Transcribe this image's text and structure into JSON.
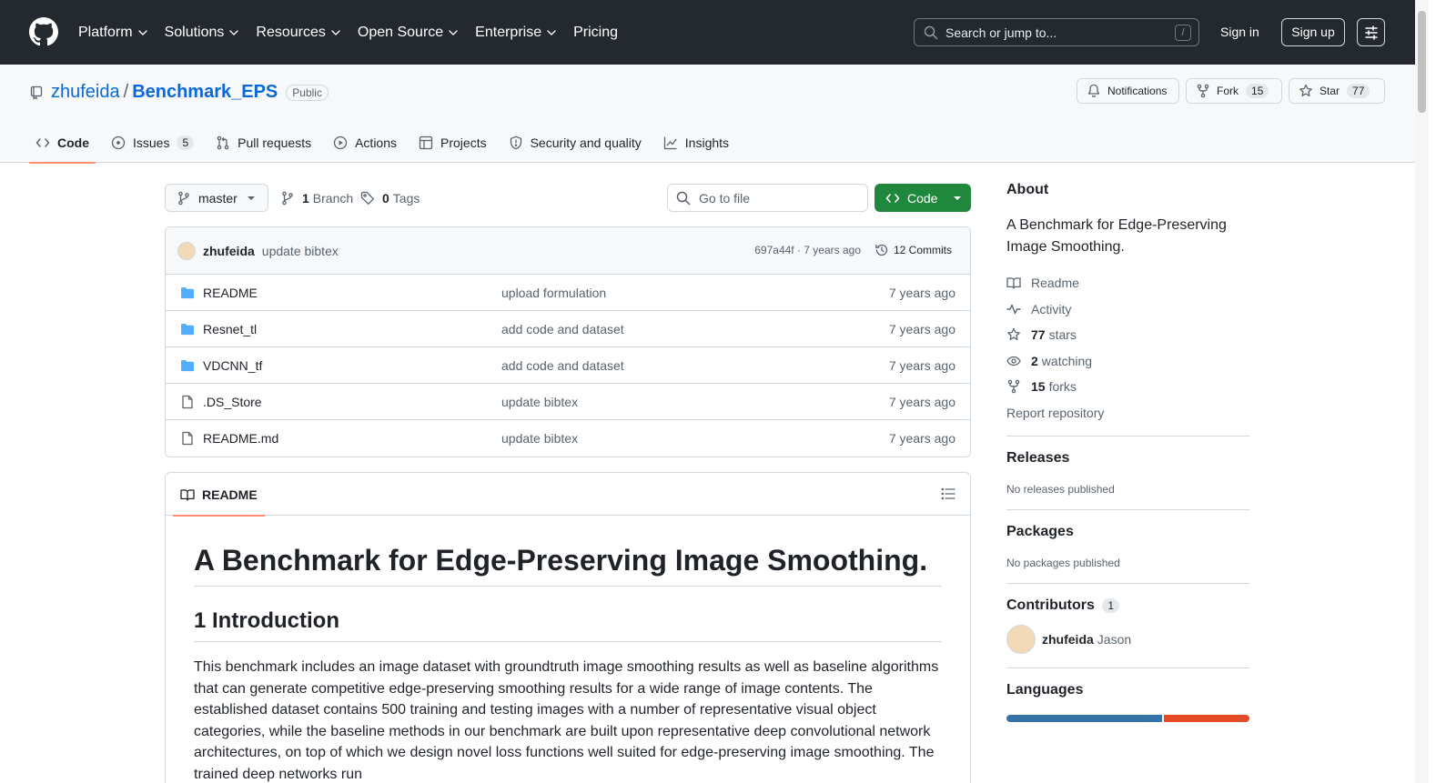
{
  "header": {
    "nav": [
      {
        "label": "Platform",
        "dropdown": true
      },
      {
        "label": "Solutions",
        "dropdown": true
      },
      {
        "label": "Resources",
        "dropdown": true
      },
      {
        "label": "Open Source",
        "dropdown": true
      },
      {
        "label": "Enterprise",
        "dropdown": true
      },
      {
        "label": "Pricing",
        "dropdown": false
      }
    ],
    "search_placeholder": "Search or jump to...",
    "search_shortcut": "/",
    "sign_in": "Sign in",
    "sign_up": "Sign up"
  },
  "repo": {
    "owner": "zhufeida",
    "separator": "/",
    "name": "Benchmark_EPS",
    "visibility": "Public",
    "notifications_label": "Notifications",
    "fork_label": "Fork",
    "fork_count": "15",
    "star_label": "Star",
    "star_count": "77",
    "tabs": [
      {
        "label": "Code",
        "count": "",
        "icon": "code-icon",
        "selected": true
      },
      {
        "label": "Issues",
        "count": "5",
        "icon": "issue-opened-icon",
        "selected": false
      },
      {
        "label": "Pull requests",
        "count": "",
        "icon": "git-pull-request-icon",
        "selected": false
      },
      {
        "label": "Actions",
        "count": "",
        "icon": "play-icon",
        "selected": false
      },
      {
        "label": "Projects",
        "count": "",
        "icon": "table-icon",
        "selected": false
      },
      {
        "label": "Security and quality",
        "count": "",
        "icon": "shield-icon",
        "selected": false
      },
      {
        "label": "Insights",
        "count": "",
        "icon": "graph-icon",
        "selected": false
      }
    ]
  },
  "filenav": {
    "branch": "master",
    "branch_count": "1",
    "branch_label": "Branch",
    "tag_count": "0",
    "tag_label": "Tags",
    "goto_placeholder": "Go to file",
    "code_button": "Code"
  },
  "commit": {
    "author": "zhufeida",
    "message": "update bibtex",
    "sha_age": "697a44f · 7 years ago",
    "commits": "12 Commits"
  },
  "files": [
    {
      "name": "README",
      "type": "folder",
      "message": "upload formulation",
      "age": "7 years ago"
    },
    {
      "name": "Resnet_tl",
      "type": "folder",
      "message": "add code and dataset",
      "age": "7 years ago"
    },
    {
      "name": "VDCNN_tf",
      "type": "folder",
      "message": "add code and dataset",
      "age": "7 years ago"
    },
    {
      "name": ".DS_Store",
      "type": "file",
      "message": "update bibtex",
      "age": "7 years ago"
    },
    {
      "name": "README.md",
      "type": "file",
      "message": "update bibtex",
      "age": "7 years ago"
    }
  ],
  "readme": {
    "tab_label": "README",
    "h1": "A Benchmark for Edge-Preserving Image Smoothing.",
    "h2": "1 Introduction",
    "paragraph": "This benchmark includes an image dataset with groundtruth image smoothing results as well as baseline algorithms that can generate competitive edge-preserving smoothing results for a wide range of image contents. The established dataset contains 500 training and testing images with a number of representative visual object categories, while the baseline methods in our benchmark are built upon representative deep convolutional network architectures, on top of which we design novel loss functions well suited for edge-preserving image smoothing. The trained deep networks run"
  },
  "sidebar": {
    "about_title": "About",
    "description": "A Benchmark for Edge-Preserving Image Smoothing.",
    "links": [
      {
        "icon": "book-icon",
        "bold": "",
        "label": "Readme"
      },
      {
        "icon": "pulse-icon",
        "bold": "",
        "label": "Activity"
      },
      {
        "icon": "star-icon",
        "bold": "77",
        "label": "stars"
      },
      {
        "icon": "eye-icon",
        "bold": "2",
        "label": "watching"
      },
      {
        "icon": "repo-forked-icon",
        "bold": "15",
        "label": "forks"
      }
    ],
    "report": "Report repository",
    "releases_title": "Releases",
    "releases_note": "No releases published",
    "packages_title": "Packages",
    "packages_note": "No packages published",
    "contributors_title": "Contributors",
    "contributors_count": "1",
    "contributor_login": "zhufeida",
    "contributor_name": "Jason",
    "languages_title": "Languages",
    "languages": [
      {
        "color": "#3572A5",
        "percent": 64.4
      },
      {
        "color": "#e34c26",
        "percent": 35.6
      }
    ]
  }
}
